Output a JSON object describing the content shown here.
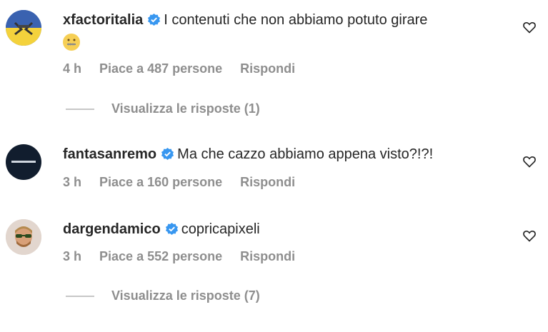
{
  "comments": [
    {
      "username": "xfactoritalia",
      "text": "I contenuti che non abbiamo potuto girare",
      "emoji_name": "zipper-mouth-face-emoji",
      "time": "4 h",
      "likes": "Piace a 487 persone",
      "reply": "Rispondi",
      "view_replies": "Visualizza le risposte (1)"
    },
    {
      "username": "fantasanremo",
      "text": "Ma che cazzo abbiamo appena visto?!?!",
      "time": "3 h",
      "likes": "Piace a 160 persone",
      "reply": "Rispondi"
    },
    {
      "username": "dargendamico",
      "text": "copricapixeli",
      "time": "3 h",
      "likes": "Piace a 552 persone",
      "reply": "Rispondi",
      "view_replies": "Visualizza le risposte (7)"
    }
  ],
  "colors": {
    "verified": "#3897f0",
    "muted": "#8e8e8e",
    "text": "#262626"
  },
  "icons": {
    "verified": "verified-badge-icon",
    "like": "heart-outline-icon"
  }
}
